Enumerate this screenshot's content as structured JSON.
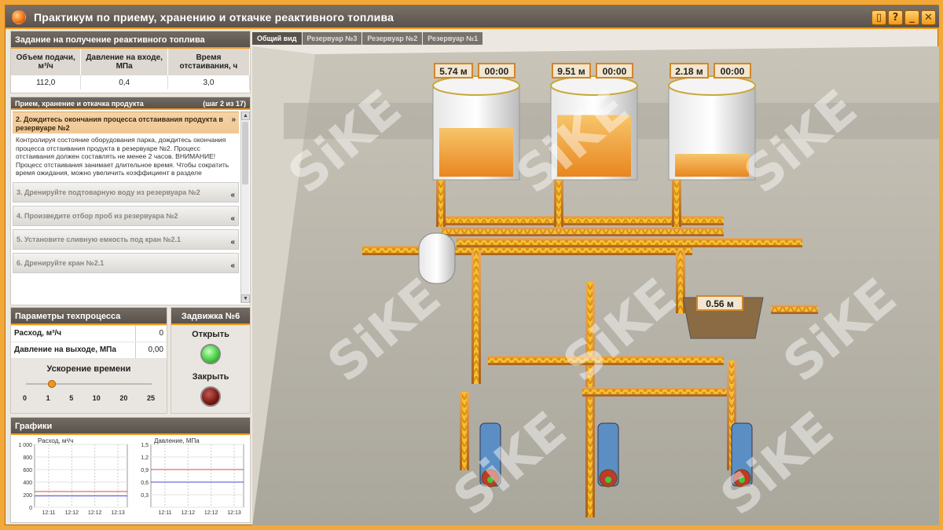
{
  "window": {
    "title": "Практикум по приему, хранению и откачке реактивного топлива",
    "buttons": [
      "▯",
      "?",
      "_",
      "✕"
    ]
  },
  "task": {
    "title": "Задание на получение реактивного топлива",
    "columns": [
      "Объем подачи, м³/ч",
      "Давление на входе, МПа",
      "Время отстаивания, ч"
    ],
    "values": [
      "112,0",
      "0,4",
      "3,0"
    ]
  },
  "steps": {
    "title": "Прием, хранение и откачка продукта",
    "progress": "(шаг 2 из 17)",
    "active": {
      "num": "2.",
      "label": "Дождитесь окончания процесса отстаивания продукта в резервуаре №2",
      "desc": "Контролируя состояние оборудования парка, дождитесь окончания процесса отстаивания продукта в резервуаре №2. Процесс отстаивания должен составлять не менее 2 часов. ВНИМАНИЕ! Процесс отстаивания занимает длительное время. Чтобы сократить время ожидания, можно увеличить коэффициент в разделе \"Параметры техпроцесса\" при помощи полосы \"Ускорение времени\"."
    },
    "items": [
      {
        "label": "3.  Дренируйте подтоварную воду из резервуара №2"
      },
      {
        "label": "4.  Произведите отбор проб из резервуара №2"
      },
      {
        "label": "5.  Установите сливную емкость под кран №2.1"
      },
      {
        "label": "6.  Дренируйте кран №2.1"
      }
    ]
  },
  "params": {
    "title": "Параметры техпроцесса",
    "flow_label": "Расход, м³/ч",
    "flow_value": "0",
    "pressure_label": "Давление на выходе, МПа",
    "pressure_value": "0,00",
    "speed_title": "Ускорение времени",
    "speed_ticks": [
      "0",
      "1",
      "5",
      "10",
      "20",
      "25"
    ],
    "speed_value": 1
  },
  "valve": {
    "title": "Задвижка №6",
    "open_label": "Открыть",
    "close_label": "Закрыть"
  },
  "graphs": {
    "title": "Графики"
  },
  "chart_data": [
    {
      "type": "line",
      "title": "Расход, м³/ч",
      "ylim": [
        0,
        1000
      ],
      "yticks": [
        "1 000",
        "800",
        "600",
        "400",
        "200",
        "0"
      ],
      "xticks": [
        "12:11",
        "12:12",
        "12:12",
        "12:13"
      ],
      "series": [
        {
          "values": [
            250,
            250,
            250,
            250
          ],
          "color": "#d94a4a"
        },
        {
          "values": [
            180,
            180,
            180,
            180
          ],
          "color": "#4a4ad9"
        }
      ]
    },
    {
      "type": "line",
      "title": "Давление, МПа",
      "ylim": [
        0,
        1.5
      ],
      "yticks": [
        "1,5",
        "1,2",
        "0,9",
        "0,6",
        "0,3",
        ""
      ],
      "xticks": [
        "12:11",
        "12:12",
        "12:12",
        "12:13"
      ],
      "series": [
        {
          "values": [
            0.9,
            0.9,
            0.9,
            0.9
          ],
          "color": "#d94a4a"
        },
        {
          "values": [
            0.6,
            0.6,
            0.6,
            0.6
          ],
          "color": "#4a4ad9"
        }
      ]
    }
  ],
  "tabs": [
    "Общий вид",
    "Резервуар №3",
    "Резервуар №2",
    "Резервуар №1"
  ],
  "scene": {
    "tanks": [
      {
        "level": "5.74 м",
        "time": "00:00"
      },
      {
        "level": "9.51 м",
        "time": "00:00"
      },
      {
        "level": "2.18 м",
        "time": "00:00"
      }
    ],
    "drain_level": "0.56 м",
    "watermark": "SiKE"
  },
  "colors": {
    "accent": "#f29a1a",
    "header": "#5a524b"
  }
}
